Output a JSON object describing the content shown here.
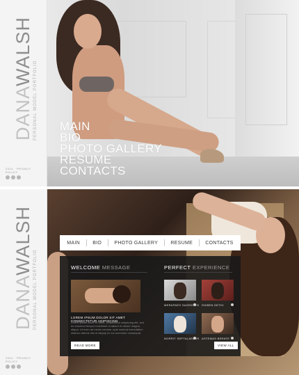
{
  "brand": {
    "first": "DANA",
    "last": "WALSH",
    "tagline": "PERSONAL MODEL PORTFOLIO",
    "footer": "2014 · PRIVACY POLICY"
  },
  "section1": {
    "menu": [
      "MAIN",
      "BIO",
      "PHOTO GALLERY",
      "RESUME",
      "CONTACTS"
    ]
  },
  "section2": {
    "nav": [
      "MAIN",
      "BIO",
      "PHOTO GALLERY",
      "RESUME",
      "CONTACTS"
    ],
    "welcome": {
      "heading_strong": "WELCOME",
      "heading_light": "MESSAGE",
      "title": "LOREM IPSUM DOLOR SIT AMET CONSECTETUR ADIPISCING",
      "text": "Lorem ipsum dolor sit amet, consectetur adipiscing elit, sed do eiusmod tempor incididunt ut labore et dolore magna aliqua. Ut enim ad minim veniam, quis nostrud exercitation ullamco laboris nisi ut aliquip ex ea commodo consequat.",
      "button": "READ MORE"
    },
    "experience": {
      "heading_strong": "PERFECT",
      "heading_light": "EXPERIENCE",
      "items": [
        "MERAPAES SAGENTYO",
        "SHIBEN DETIO",
        "NORRIT SEPTALAEDER",
        "ASTEMAS BERATE"
      ],
      "button": "VIEW ALL"
    }
  },
  "colors": {
    "accent": "#ffffff",
    "panel": "#191919",
    "strip": "#f4f4f4"
  }
}
